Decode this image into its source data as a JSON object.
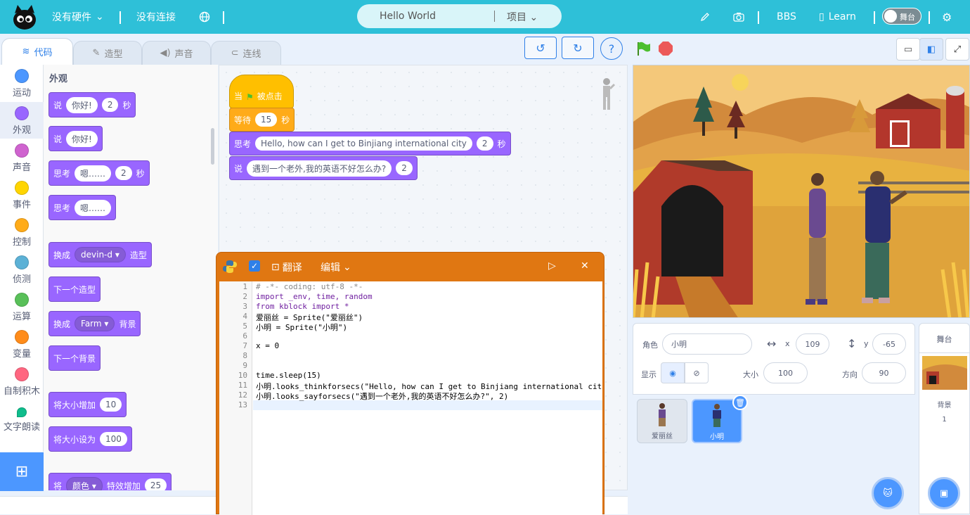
{
  "topbar": {
    "hardware": "没有硬件",
    "connection": "没有连接",
    "project_name": "Hello World",
    "project_menu": "项目",
    "bbs": "BBS",
    "learn": "Learn",
    "stage_toggle": "舞台"
  },
  "tabs": {
    "code": "代码",
    "costume": "造型",
    "sound": "声音",
    "connect": "连线"
  },
  "categories": [
    {
      "label": "运动",
      "color": "#4c97ff"
    },
    {
      "label": "外观",
      "color": "#9966ff"
    },
    {
      "label": "声音",
      "color": "#cf63cf"
    },
    {
      "label": "事件",
      "color": "#ffd500"
    },
    {
      "label": "控制",
      "color": "#ffab19"
    },
    {
      "label": "侦测",
      "color": "#5cb1d6"
    },
    {
      "label": "运算",
      "color": "#59c059"
    },
    {
      "label": "变量",
      "color": "#ff8c1a"
    },
    {
      "label": "自制积木",
      "color": "#ff6680"
    },
    {
      "label": "文字朗读",
      "color": "#0fbd8c"
    }
  ],
  "palette": {
    "title": "外观",
    "say_secs": {
      "say": "说",
      "msg": "你好!",
      "secs": "2",
      "unit": "秒"
    },
    "say": {
      "say": "说",
      "msg": "你好!"
    },
    "think_secs": {
      "think": "思考",
      "msg": "嗯……",
      "secs": "2",
      "unit": "秒"
    },
    "think": {
      "think": "思考",
      "msg": "嗯……"
    },
    "switch_costume": {
      "pre": "换成",
      "val": "devin-d",
      "post": "造型"
    },
    "next_costume": "下一个造型",
    "switch_backdrop": {
      "pre": "换成",
      "val": "Farm",
      "post": "背景"
    },
    "next_backdrop": "下一个背景",
    "change_size": {
      "label": "将大小增加",
      "val": "10"
    },
    "set_size": {
      "label": "将大小设为",
      "val": "100"
    },
    "effect": {
      "pre": "将",
      "val": "颜色",
      "post": "特效增加",
      "num": "25"
    }
  },
  "script": {
    "hat": {
      "when": "当",
      "clicked": "被点击"
    },
    "wait": {
      "label": "等待",
      "val": "15",
      "unit": "秒"
    },
    "think": {
      "label": "思考",
      "msg": "Hello, how can I get to Binjiang international city",
      "secs": "2",
      "unit": "秒"
    },
    "say": {
      "label": "说",
      "msg": "遇到一个老外,我的英语不好怎么办?",
      "secs": "2"
    }
  },
  "python": {
    "translate": "翻译",
    "edit": "编辑"
  },
  "code_lines": [
    "# -*- coding: utf-8 -*-",
    "import _env, time, random",
    "from kblock import *",
    "爱丽丝 = Sprite(\"爱丽丝\")",
    "小明 = Sprite(\"小明\")",
    "",
    "x = 0",
    "",
    "",
    "time.sleep(15)",
    "小明.looks_thinkforsecs(\"Hello, how can I get to Binjiang international cit",
    "小明.looks_sayforsecs(\"遇到一个老外,我的英语不好怎么办?\", 2)",
    ""
  ],
  "sprite_info": {
    "sprite_label": "角色",
    "sprite_name": "小明",
    "x_label": "x",
    "x": "109",
    "y_label": "y",
    "y": "-65",
    "show_label": "显示",
    "size_label": "大小",
    "size": "100",
    "direction_label": "方向",
    "direction": "90"
  },
  "sprites": [
    {
      "name": "爱丽丝"
    },
    {
      "name": "小明"
    }
  ],
  "backdrop_panel": {
    "title": "舞台",
    "label": "背景",
    "count": "1"
  }
}
